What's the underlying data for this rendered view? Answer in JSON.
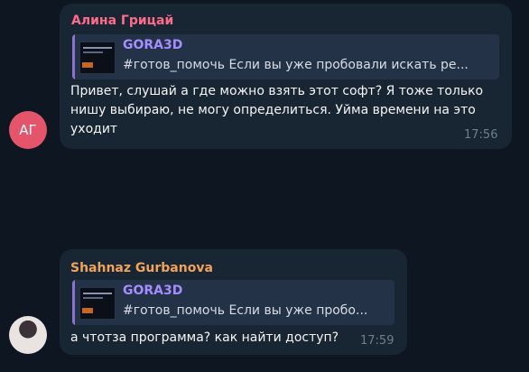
{
  "messages": [
    {
      "sender": "Алина Грицай",
      "sender_color": "#ff6b8c",
      "avatar_initials": "АГ",
      "avatar_color": "#e4556b",
      "reply": {
        "title": "GORA3D",
        "text": "#готов_помочь  Если вы уже пробовали искать ре..."
      },
      "text": "Привет, слушай а где можно взять этот софт? Я тоже только нишу выбираю, не могу определиться. Уйма времени на это уходит",
      "time": "17:56"
    },
    {
      "sender": "Shahnaz Gurbanova",
      "sender_color": "#f0a35a",
      "avatar_type": "photo",
      "reply": {
        "title": "GORA3D",
        "text": "#готов_помочь  Если вы уже пробо..."
      },
      "text": "а чтотза программа? как найти доступ?",
      "time": "17:59"
    }
  ],
  "colors": {
    "background": "#0e1621",
    "bubble": "#182533",
    "reply_background": "#233246",
    "reply_accent": "#8c72d0",
    "reply_title": "#a58dff",
    "time": "#6d7f8f"
  }
}
